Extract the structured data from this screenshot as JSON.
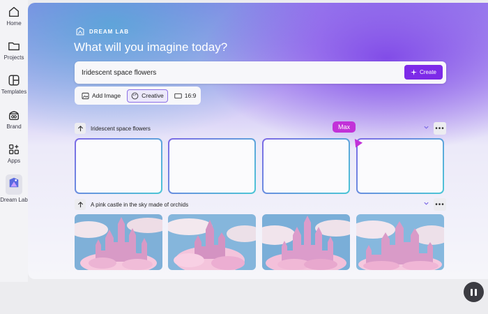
{
  "sidebar": {
    "items": [
      {
        "label": "Home",
        "icon": "home-icon"
      },
      {
        "label": "Projects",
        "icon": "folder-icon"
      },
      {
        "label": "Templates",
        "icon": "templates-icon"
      },
      {
        "label": "Brand",
        "icon": "brand-icon"
      },
      {
        "label": "Apps",
        "icon": "apps-icon"
      },
      {
        "label": "Dream Lab",
        "icon": "dream-lab-icon"
      }
    ]
  },
  "header": {
    "brand": "DREAM LAB",
    "headline": "What will you imagine today?"
  },
  "prompt": {
    "value": "Iridescent space flowers",
    "create_label": "Create"
  },
  "options": {
    "add_image": "Add Image",
    "style": "Creative",
    "aspect": "16:9"
  },
  "rows": [
    {
      "prompt": "Iridescent space flowers",
      "status": "generating"
    },
    {
      "prompt": "A pink castle in the sky made of orchids",
      "status": "complete"
    }
  ],
  "collaborator": {
    "name": "Max"
  },
  "colors": {
    "accent": "#7d2ae8",
    "collaborator": "#c231d8"
  }
}
